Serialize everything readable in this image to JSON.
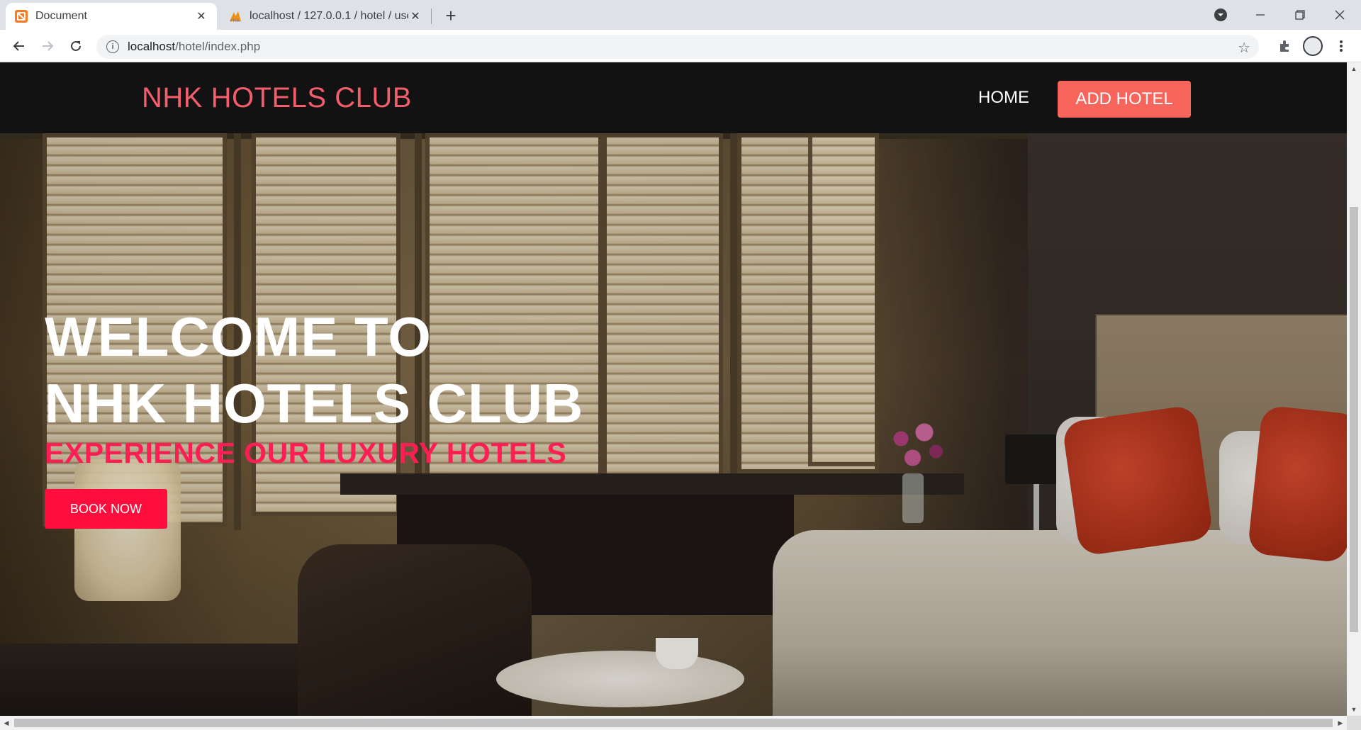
{
  "browser": {
    "tabs": [
      {
        "title": "Document",
        "favicon": "xampp-icon",
        "active": true
      },
      {
        "title": "localhost / 127.0.0.1 / hotel / use",
        "favicon": "phpmyadmin-icon",
        "active": false
      }
    ],
    "new_tab_label": "+",
    "url_host": "localhost",
    "url_path": "/hotel/index.php"
  },
  "site": {
    "brand": "NHK HOTELS CLUB",
    "nav": {
      "home": "HOME",
      "add_hotel": "ADD HOTEL"
    },
    "hero": {
      "title_line1": "WELCOME TO",
      "title_line2": "NHK HOTELS CLUB",
      "subtitle": "EXPERIENCE OUR LUXURY HOTELS",
      "cta": "BOOK NOW"
    }
  },
  "colors": {
    "brand": "#f45d6b",
    "add_hotel_button": "#f8655c",
    "subtitle": "#ff1e54",
    "cta_button": "#ff0d3c",
    "nav_bg": "#121212"
  }
}
